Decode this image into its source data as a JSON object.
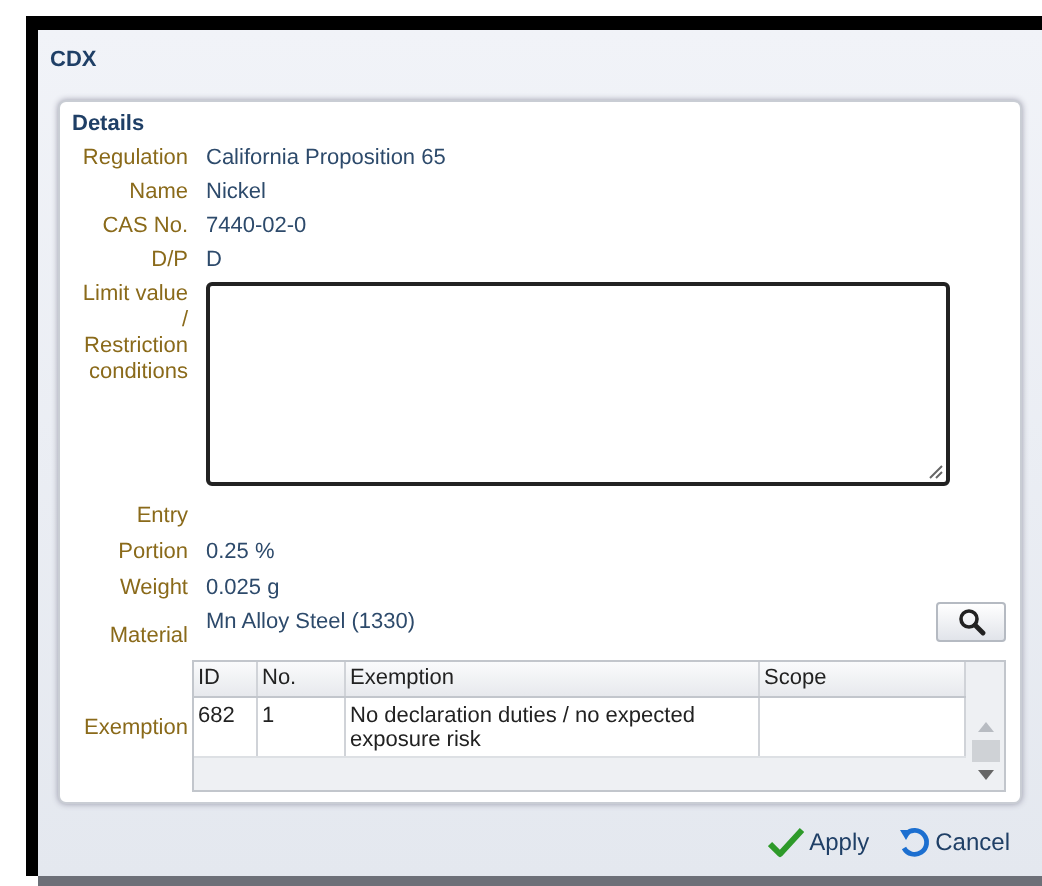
{
  "window": {
    "title": "CDX"
  },
  "details": {
    "title": "Details",
    "fields": [
      {
        "label": "Regulation",
        "value": "California Proposition 65"
      },
      {
        "label": "Name",
        "value": "Nickel"
      },
      {
        "label": "CAS No.",
        "value": "7440-02-0"
      },
      {
        "label": "D/P",
        "value": "D"
      }
    ],
    "limit": {
      "label": "Limit value / Restriction conditions"
    },
    "entry": {
      "label": "Entry"
    },
    "amounts": [
      {
        "label": "Portion",
        "value": "0.25 %"
      },
      {
        "label": "Weight",
        "value": "0.025 g"
      }
    ],
    "material": {
      "label": "Material",
      "value": "Mn Alloy Steel (1330)"
    },
    "exemption": {
      "label": "Exemption",
      "columns": [
        "ID",
        "No.",
        "Exemption",
        "Scope"
      ],
      "rows": [
        [
          "682",
          "1",
          "No declaration duties / no expected exposure risk",
          ""
        ]
      ]
    }
  },
  "buttons": [
    {
      "label": "Apply",
      "kind": "apply"
    },
    {
      "label": "Cancel",
      "kind": "cancel"
    }
  ]
}
